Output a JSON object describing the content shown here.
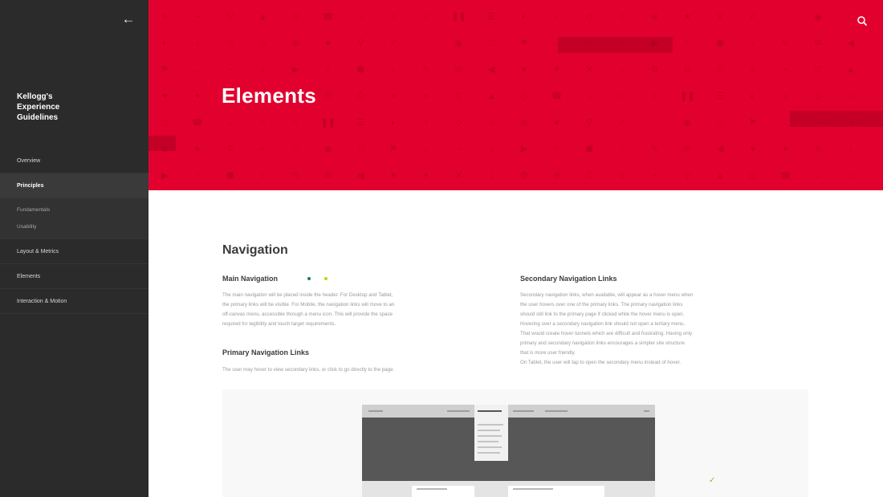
{
  "sidebar": {
    "back_icon": "arrow-left-icon",
    "brand": [
      "Kellogg's",
      "Experience",
      "Guidelines"
    ],
    "nav": {
      "overview": "Overview",
      "principles": "Principles",
      "fundamentals": "Fundamentals",
      "usability": "Usability",
      "layout_metrics": "Layout & Metrics",
      "elements": "Elements",
      "interaction_motion": "Interaction & Motion"
    }
  },
  "hero": {
    "title": "Elements",
    "search_icon": "search-icon",
    "background_color": "#e2002e"
  },
  "content": {
    "section_title": "Navigation",
    "main_nav": {
      "heading": "Main Navigation",
      "lines": [
        "The main navigation will be placed inside the header. For Desktop and Tablet,",
        "the primary links will be visible. For Mobile, the navigation links will move to an",
        "off-canvas menu, accessible through a menu icon. This will provide the space",
        "required for legibility and touch target requirements."
      ],
      "dot_colors": [
        "#1a7a6b",
        "#c6d300"
      ]
    },
    "primary_links": {
      "heading": "Primary Navigation Links",
      "text": "The user may hover to view secondary links, or click to go directly to the page."
    },
    "secondary_links": {
      "heading": "Secondary Navigation Links",
      "lines": [
        "Secondary navigation links, when available, will appear as a hover menu when",
        "the user hovers over one of the primary links. The primary navigation links",
        "should still link to the primary page if clicked while the hover menu is open.",
        "Hovering over a secondary navigation link should not open a tertiary menu.",
        "That would create hover tunnels which are difficult and frustrating. Having only",
        "primary and secondary navigation links encourages a simpler site structure",
        "that is more user friendly.",
        "On Tablet, the user will tap to open the secondary menu instead of hover."
      ]
    },
    "illustration": {
      "check_icon": "checkmark-icon",
      "check_color": "#7fbf3f"
    }
  }
}
